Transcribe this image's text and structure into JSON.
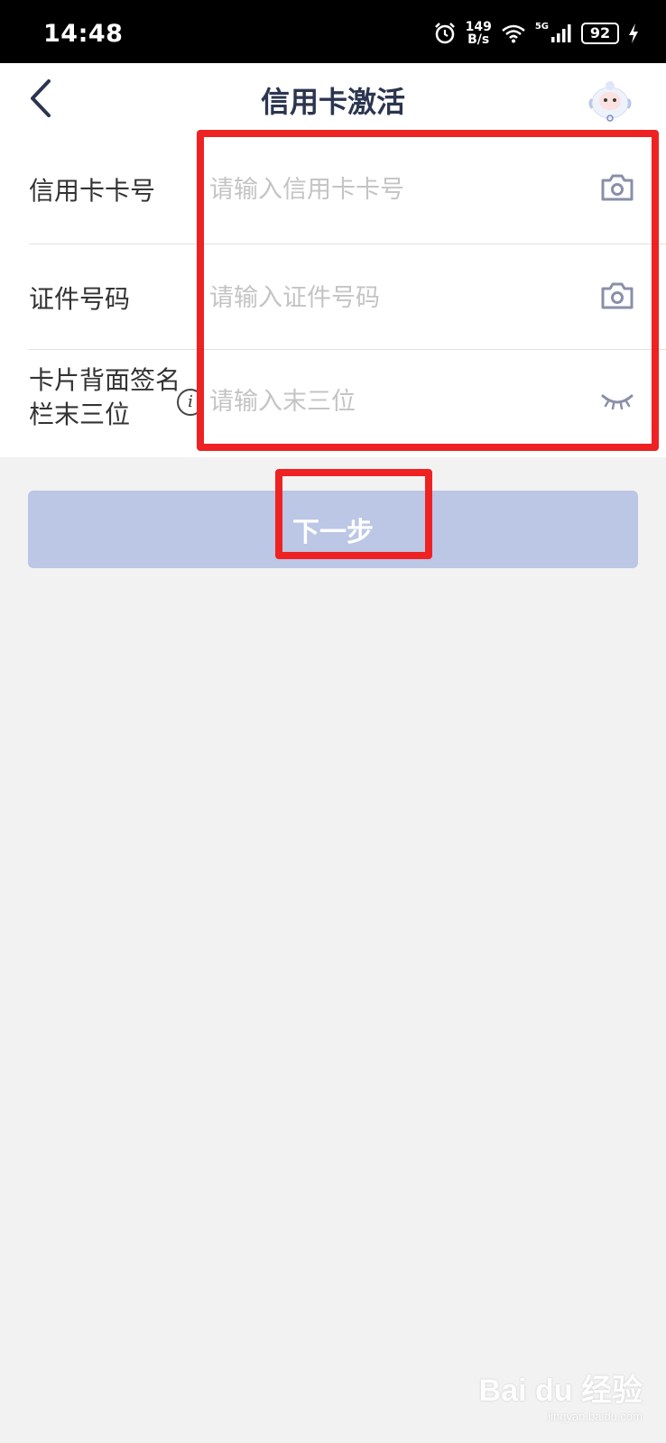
{
  "status_bar": {
    "time": "14:48",
    "net_speed_value": "149",
    "net_speed_unit": "B/s",
    "signal_label": "5G",
    "battery": "92"
  },
  "nav": {
    "title": "信用卡激活"
  },
  "form": {
    "card_number": {
      "label": "信用卡卡号",
      "placeholder": "请输入信用卡卡号",
      "value": ""
    },
    "id_number": {
      "label": "证件号码",
      "placeholder": "请输入证件号码",
      "value": ""
    },
    "cvv": {
      "label": "卡片背面签名栏末三位",
      "placeholder": "请输入末三位",
      "value": ""
    }
  },
  "next_button": {
    "label": "下一步"
  },
  "watermark": {
    "main": "Bai du 经验",
    "sub": "jingyan.baidu.com"
  },
  "colors": {
    "annotation": "#ee2222",
    "button_disabled": "#bcc6e5",
    "title": "#2c3550",
    "icon": "#8a8fa8"
  }
}
